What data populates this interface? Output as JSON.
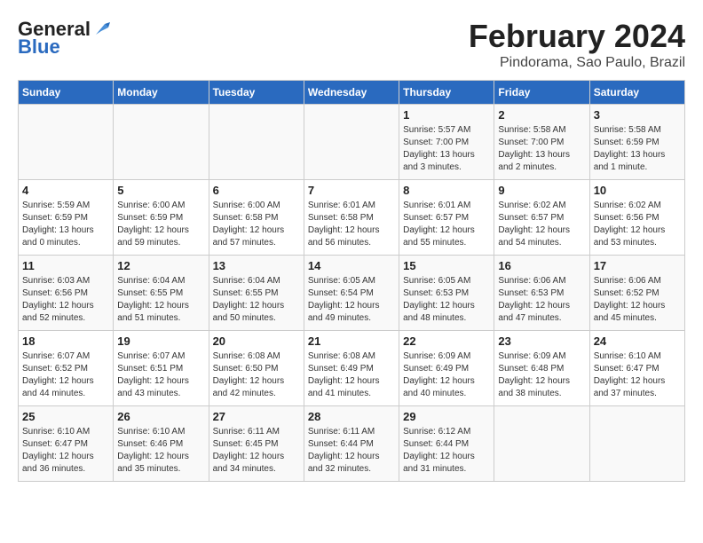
{
  "header": {
    "logo_line1": "General",
    "logo_line2": "Blue",
    "month": "February 2024",
    "location": "Pindorama, Sao Paulo, Brazil"
  },
  "weekdays": [
    "Sunday",
    "Monday",
    "Tuesday",
    "Wednesday",
    "Thursday",
    "Friday",
    "Saturday"
  ],
  "weeks": [
    [
      {
        "day": "",
        "info": ""
      },
      {
        "day": "",
        "info": ""
      },
      {
        "day": "",
        "info": ""
      },
      {
        "day": "",
        "info": ""
      },
      {
        "day": "1",
        "info": "Sunrise: 5:57 AM\nSunset: 7:00 PM\nDaylight: 13 hours\nand 3 minutes."
      },
      {
        "day": "2",
        "info": "Sunrise: 5:58 AM\nSunset: 7:00 PM\nDaylight: 13 hours\nand 2 minutes."
      },
      {
        "day": "3",
        "info": "Sunrise: 5:58 AM\nSunset: 6:59 PM\nDaylight: 13 hours\nand 1 minute."
      }
    ],
    [
      {
        "day": "4",
        "info": "Sunrise: 5:59 AM\nSunset: 6:59 PM\nDaylight: 13 hours\nand 0 minutes."
      },
      {
        "day": "5",
        "info": "Sunrise: 6:00 AM\nSunset: 6:59 PM\nDaylight: 12 hours\nand 59 minutes."
      },
      {
        "day": "6",
        "info": "Sunrise: 6:00 AM\nSunset: 6:58 PM\nDaylight: 12 hours\nand 57 minutes."
      },
      {
        "day": "7",
        "info": "Sunrise: 6:01 AM\nSunset: 6:58 PM\nDaylight: 12 hours\nand 56 minutes."
      },
      {
        "day": "8",
        "info": "Sunrise: 6:01 AM\nSunset: 6:57 PM\nDaylight: 12 hours\nand 55 minutes."
      },
      {
        "day": "9",
        "info": "Sunrise: 6:02 AM\nSunset: 6:57 PM\nDaylight: 12 hours\nand 54 minutes."
      },
      {
        "day": "10",
        "info": "Sunrise: 6:02 AM\nSunset: 6:56 PM\nDaylight: 12 hours\nand 53 minutes."
      }
    ],
    [
      {
        "day": "11",
        "info": "Sunrise: 6:03 AM\nSunset: 6:56 PM\nDaylight: 12 hours\nand 52 minutes."
      },
      {
        "day": "12",
        "info": "Sunrise: 6:04 AM\nSunset: 6:55 PM\nDaylight: 12 hours\nand 51 minutes."
      },
      {
        "day": "13",
        "info": "Sunrise: 6:04 AM\nSunset: 6:55 PM\nDaylight: 12 hours\nand 50 minutes."
      },
      {
        "day": "14",
        "info": "Sunrise: 6:05 AM\nSunset: 6:54 PM\nDaylight: 12 hours\nand 49 minutes."
      },
      {
        "day": "15",
        "info": "Sunrise: 6:05 AM\nSunset: 6:53 PM\nDaylight: 12 hours\nand 48 minutes."
      },
      {
        "day": "16",
        "info": "Sunrise: 6:06 AM\nSunset: 6:53 PM\nDaylight: 12 hours\nand 47 minutes."
      },
      {
        "day": "17",
        "info": "Sunrise: 6:06 AM\nSunset: 6:52 PM\nDaylight: 12 hours\nand 45 minutes."
      }
    ],
    [
      {
        "day": "18",
        "info": "Sunrise: 6:07 AM\nSunset: 6:52 PM\nDaylight: 12 hours\nand 44 minutes."
      },
      {
        "day": "19",
        "info": "Sunrise: 6:07 AM\nSunset: 6:51 PM\nDaylight: 12 hours\nand 43 minutes."
      },
      {
        "day": "20",
        "info": "Sunrise: 6:08 AM\nSunset: 6:50 PM\nDaylight: 12 hours\nand 42 minutes."
      },
      {
        "day": "21",
        "info": "Sunrise: 6:08 AM\nSunset: 6:49 PM\nDaylight: 12 hours\nand 41 minutes."
      },
      {
        "day": "22",
        "info": "Sunrise: 6:09 AM\nSunset: 6:49 PM\nDaylight: 12 hours\nand 40 minutes."
      },
      {
        "day": "23",
        "info": "Sunrise: 6:09 AM\nSunset: 6:48 PM\nDaylight: 12 hours\nand 38 minutes."
      },
      {
        "day": "24",
        "info": "Sunrise: 6:10 AM\nSunset: 6:47 PM\nDaylight: 12 hours\nand 37 minutes."
      }
    ],
    [
      {
        "day": "25",
        "info": "Sunrise: 6:10 AM\nSunset: 6:47 PM\nDaylight: 12 hours\nand 36 minutes."
      },
      {
        "day": "26",
        "info": "Sunrise: 6:10 AM\nSunset: 6:46 PM\nDaylight: 12 hours\nand 35 minutes."
      },
      {
        "day": "27",
        "info": "Sunrise: 6:11 AM\nSunset: 6:45 PM\nDaylight: 12 hours\nand 34 minutes."
      },
      {
        "day": "28",
        "info": "Sunrise: 6:11 AM\nSunset: 6:44 PM\nDaylight: 12 hours\nand 32 minutes."
      },
      {
        "day": "29",
        "info": "Sunrise: 6:12 AM\nSunset: 6:44 PM\nDaylight: 12 hours\nand 31 minutes."
      },
      {
        "day": "",
        "info": ""
      },
      {
        "day": "",
        "info": ""
      }
    ]
  ]
}
